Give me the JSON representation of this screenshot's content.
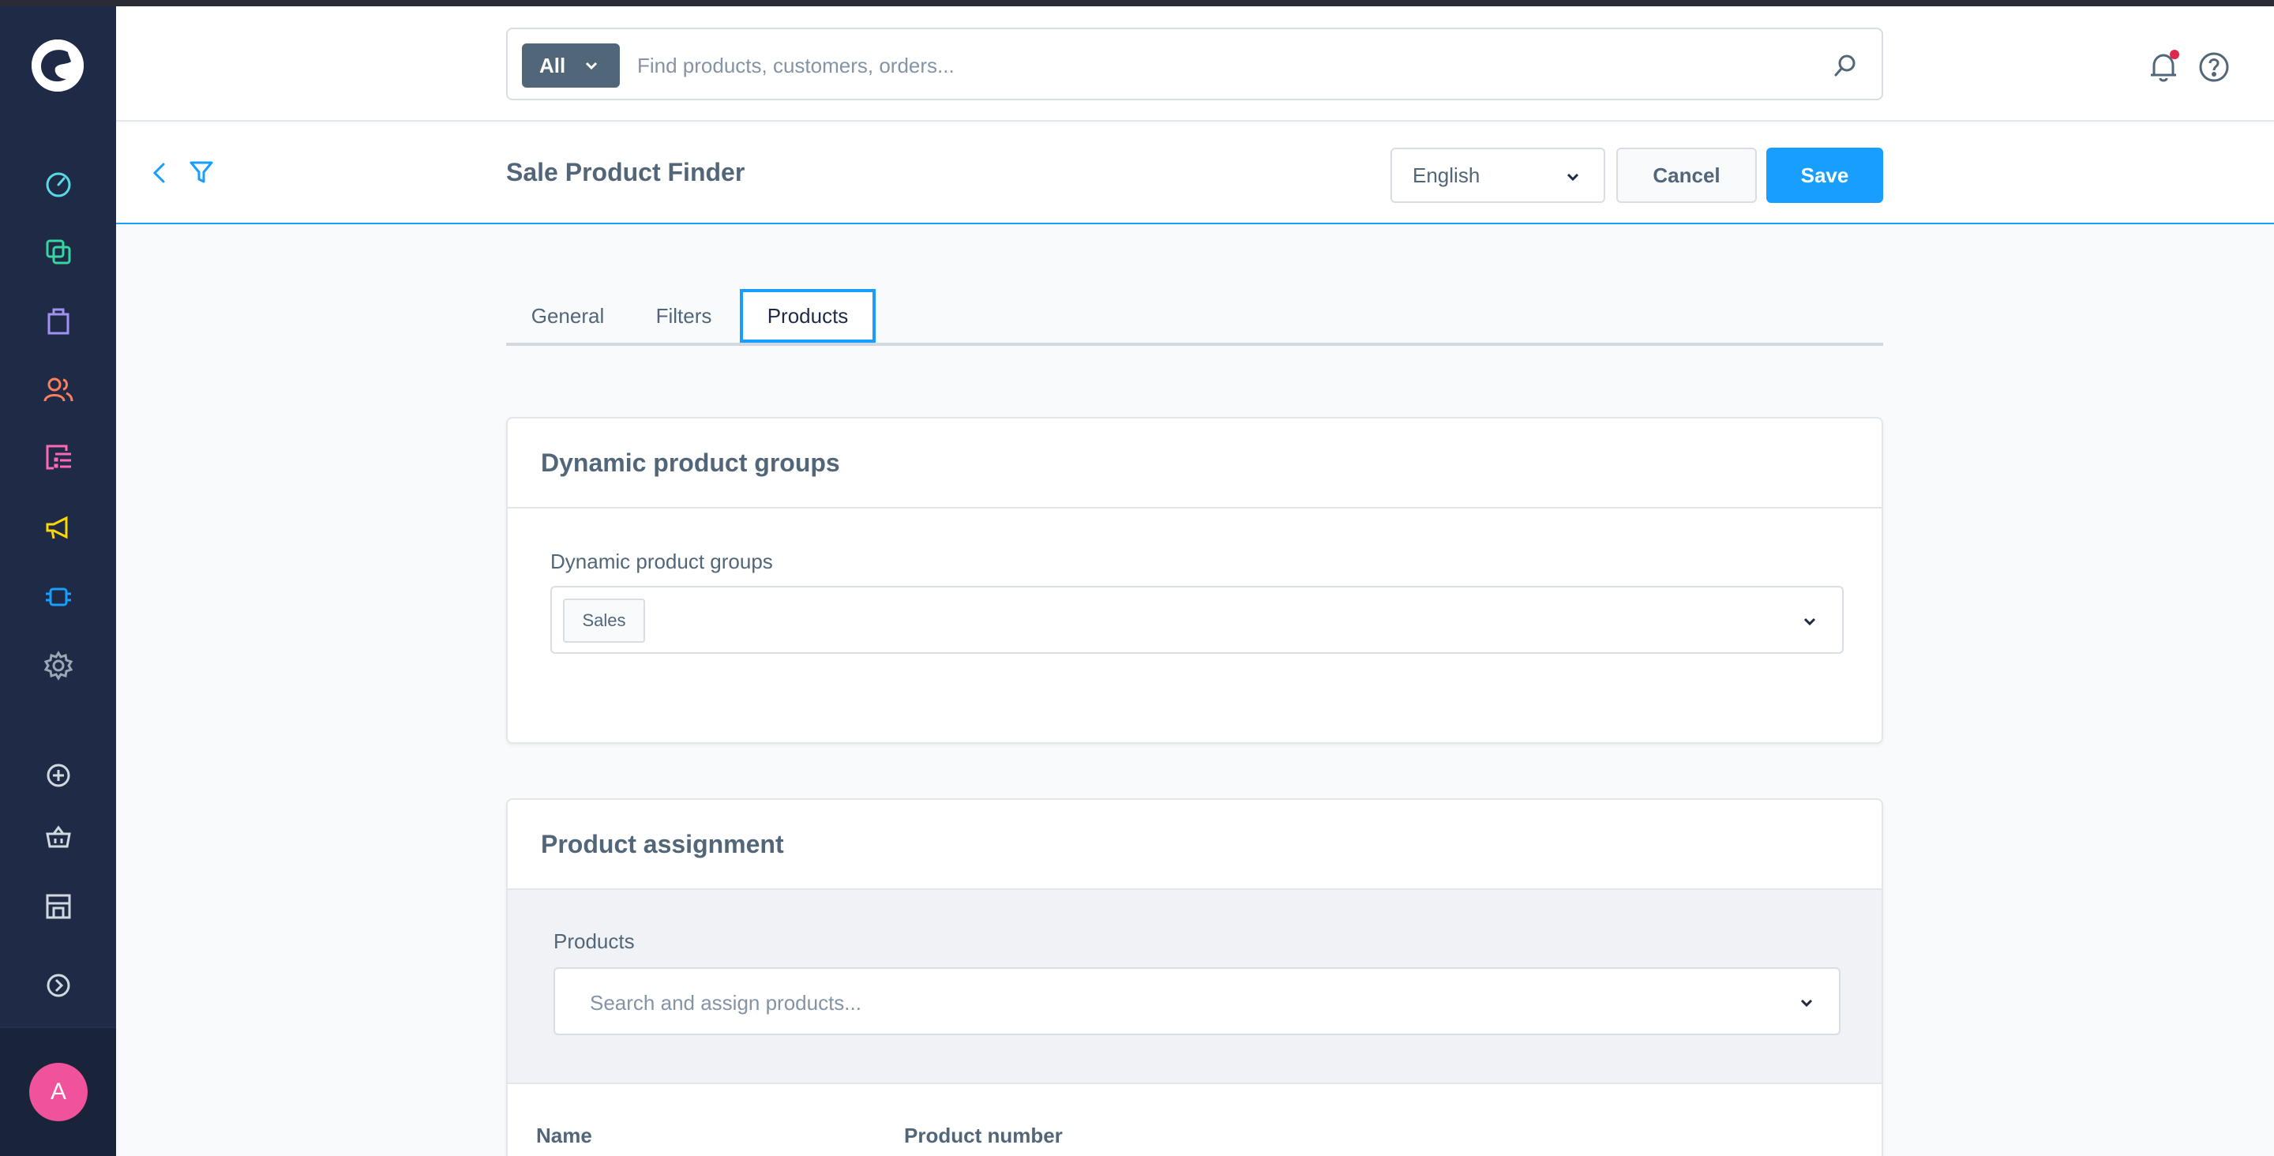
{
  "sidebar": {
    "icons": [
      "dashboard-icon",
      "catalog-icon",
      "orders-icon",
      "customers-icon",
      "content-icon",
      "marketing-icon",
      "extensions-icon",
      "settings-icon",
      "add-icon",
      "basket-icon",
      "store-icon",
      "expand-icon"
    ],
    "avatar_initial": "A"
  },
  "search": {
    "type_label": "All",
    "placeholder": "Find products, customers, orders..."
  },
  "smartbar": {
    "title": "Sale Product Finder",
    "language": "English",
    "cancel_label": "Cancel",
    "save_label": "Save"
  },
  "tabs": [
    {
      "label": "General"
    },
    {
      "label": "Filters"
    },
    {
      "label": "Products",
      "active": true
    }
  ],
  "dynamic_groups_card": {
    "title": "Dynamic product groups",
    "field_label": "Dynamic product groups",
    "selected": [
      "Sales"
    ]
  },
  "assignment_card": {
    "title": "Product assignment",
    "field_label": "Products",
    "placeholder": "Search and assign products...",
    "columns": [
      "Name",
      "Product number"
    ]
  },
  "colors": {
    "sidebar_bg": "#1f2b46",
    "accent": "#189eff",
    "text": "#52667a",
    "avatar": "#f0529c",
    "notification_dot": "#de294c"
  }
}
